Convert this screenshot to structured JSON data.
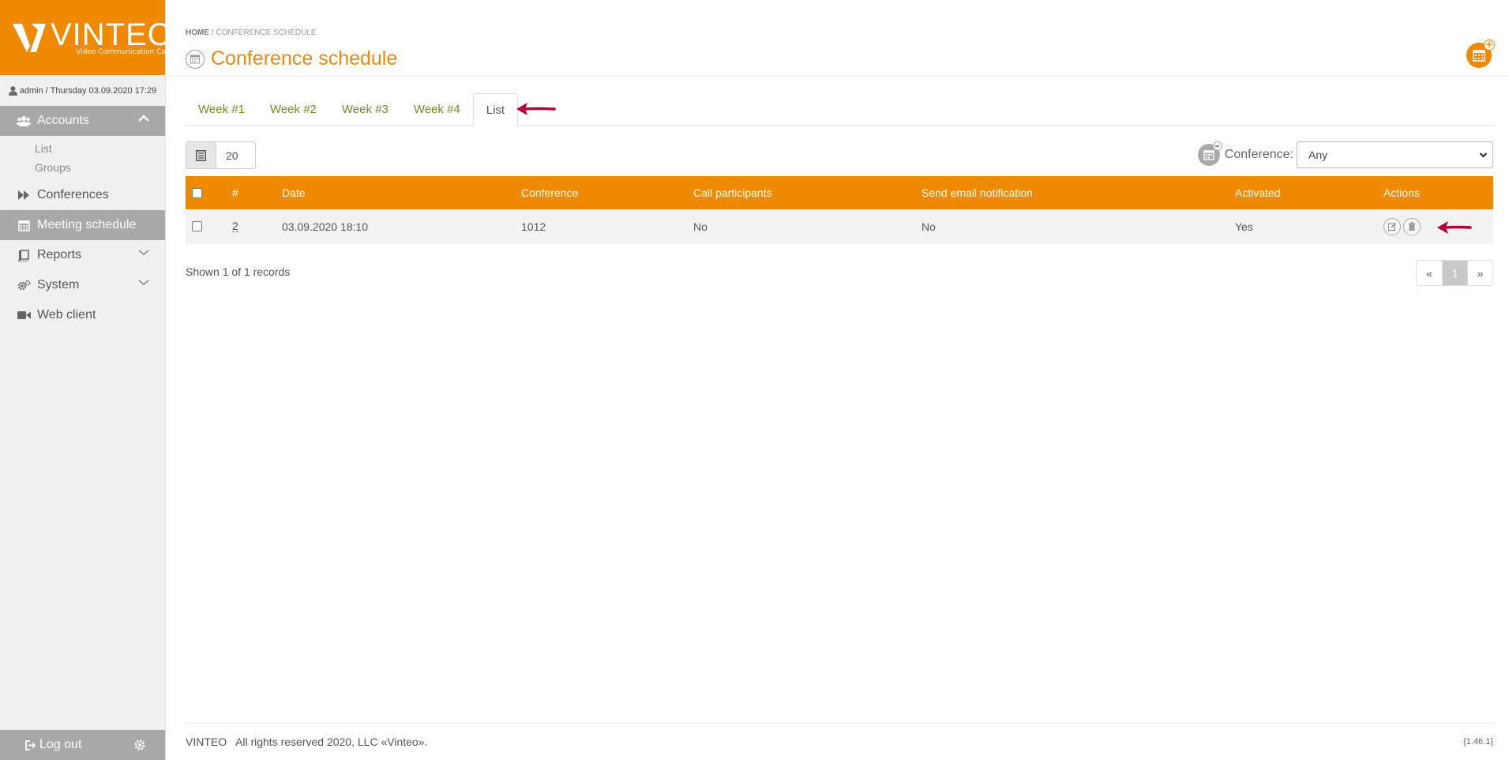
{
  "brand": {
    "name": "VINTEO",
    "tagline": "Video Communication Core",
    "accent_color": "#ef8a00"
  },
  "user": {
    "line": "admin / Thursday 03.09.2020 17:29"
  },
  "sidebar": {
    "items": [
      {
        "label": "Accounts",
        "icon": "users-icon",
        "active": true,
        "expanded": true,
        "children": [
          {
            "label": "List"
          },
          {
            "label": "Groups"
          }
        ]
      },
      {
        "label": "Conferences",
        "icon": "forward-icon"
      },
      {
        "label": "Meeting schedule",
        "icon": "calendar-icon",
        "active": true
      },
      {
        "label": "Reports",
        "icon": "book-icon",
        "chevron": "down"
      },
      {
        "label": "System",
        "icon": "gears-icon",
        "chevron": "down"
      },
      {
        "label": "Web client",
        "icon": "video-camera-icon"
      }
    ],
    "logout_label": "Log out"
  },
  "header": {
    "breadcrumb_home": "HOME",
    "breadcrumb_sep": "/",
    "breadcrumb_current": "CONFERENCE SCHEDULE",
    "title": "Conference schedule"
  },
  "tabs": [
    {
      "label": "Week #1"
    },
    {
      "label": "Week #2"
    },
    {
      "label": "Week #3"
    },
    {
      "label": "Week #4"
    },
    {
      "label": "List",
      "active": true
    }
  ],
  "toolbar": {
    "page_size": "20",
    "filter_label": "Conference:",
    "filter_value": "Any"
  },
  "table": {
    "columns": [
      "#",
      "Date",
      "Conference",
      "Call participants",
      "Send email notification",
      "Activated",
      "Actions"
    ],
    "rows": [
      {
        "id": "2",
        "date": "03.09.2020 18:10",
        "conference": "1012",
        "call_participants": "No",
        "send_email": "No",
        "activated": "Yes"
      }
    ]
  },
  "records_text": "Shown 1 of 1 records",
  "pagination": {
    "prev": "«",
    "current": "1",
    "next": "»"
  },
  "footer": {
    "copyright": "VINTEO   All rights reserved 2020, LLC «Vinteo».",
    "version": "{1.46.1}"
  },
  "annotation_color": "#b0003a"
}
